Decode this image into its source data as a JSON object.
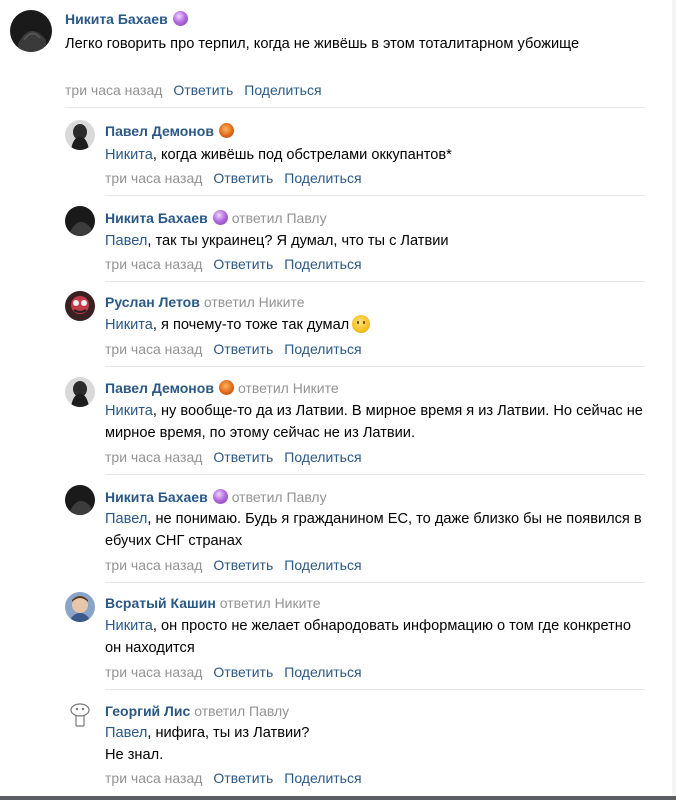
{
  "actions": {
    "reply": "Ответить",
    "share": "Поделиться"
  },
  "comments": [
    {
      "author": "Никита Бахаев",
      "badge": "crystal",
      "replied_to": "",
      "mention": "",
      "text": "Легко говорить про терпил, когда не живёшь в этом тоталитарном убожище",
      "time": "три часа назад"
    },
    {
      "author": "Павел Демонов",
      "badge": "pumpkin",
      "replied_to": "",
      "mention": "Никита",
      "text": ", когда живёшь под обстрелами оккупантов*",
      "time": "три часа назад"
    },
    {
      "author": "Никита Бахаев",
      "badge": "crystal",
      "replied_to": "ответил Павлу",
      "mention": "Павел",
      "text": ", так ты украинец? Я думал, что ты с Латвии",
      "time": "три часа назад"
    },
    {
      "author": "Руслан Летов",
      "badge": "",
      "replied_to": "ответил Никите",
      "mention": "Никита",
      "text": ", я почему-то тоже так думал",
      "emoji": "thinking-face-emoji",
      "time": "три часа назад"
    },
    {
      "author": "Павел Демонов",
      "badge": "pumpkin",
      "replied_to": "ответил Никите",
      "mention": "Никита",
      "text": ", ну вообще-то да из Латвии. В мирное время я из Латвии. Но сейчас не мирное время, по этому сейчас не из Латвии.",
      "time": "три часа назад"
    },
    {
      "author": "Никита Бахаев",
      "badge": "crystal",
      "replied_to": "ответил Павлу",
      "mention": "Павел",
      "text": ", не понимаю. Будь я гражданином ЕС, то даже близко бы не появился в ебучих СНГ странах",
      "time": "три часа назад"
    },
    {
      "author": "Всратый Кашин",
      "badge": "",
      "replied_to": "ответил Никите",
      "mention": "Никита",
      "text": ", он просто не желает обнародовать информацию о том где конкретно он находится",
      "time": "три часа назад"
    },
    {
      "author": "Георгий Лис",
      "badge": "",
      "replied_to": "ответил Павлу",
      "mention": "Павел",
      "text": ", нифига, ты из Латвии?\nНе знал.",
      "time": "три часа назад"
    }
  ],
  "colors": {
    "link": "#2a5885",
    "meta": "#939393",
    "divider": "#e7e8ec"
  }
}
